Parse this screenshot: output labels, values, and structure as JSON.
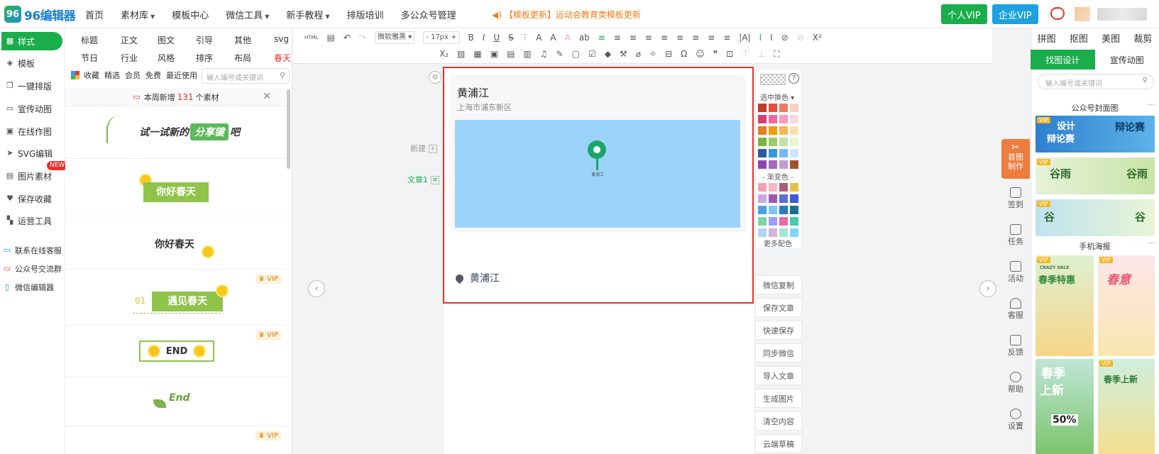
{
  "app": {
    "name": "96编辑器",
    "logo_mark": "96"
  },
  "nav": {
    "items": [
      {
        "label": "首页",
        "caret": false
      },
      {
        "label": "素材库",
        "caret": true
      },
      {
        "label": "模板中心",
        "caret": false
      },
      {
        "label": "微信工具",
        "caret": true
      },
      {
        "label": "新手教程",
        "caret": true
      },
      {
        "label": "排版培训",
        "caret": false
      },
      {
        "label": "多公众号管理",
        "caret": false
      }
    ],
    "notice": "【模板更新】运动会教育类模板更新"
  },
  "header_buttons": {
    "personal_vip": "个人VIP",
    "company_vip": "企业VIP"
  },
  "left_nav": {
    "items": [
      {
        "label": "样式",
        "icon": "grid-icon"
      },
      {
        "label": "模板",
        "icon": "layers-icon"
      },
      {
        "label": "一键排版",
        "icon": "copy-icon"
      },
      {
        "label": "宣传动图",
        "icon": "gif-icon"
      },
      {
        "label": "在线作图",
        "icon": "image-icon"
      },
      {
        "label": "SVG编辑",
        "icon": "pointer-icon"
      },
      {
        "label": "图片素材",
        "icon": "picture-icon"
      },
      {
        "label": "保存收藏",
        "icon": "heart-icon"
      },
      {
        "label": "运营工具",
        "icon": "apps-icon"
      }
    ],
    "new_badge": "NEW",
    "links": [
      {
        "label": "联系在线客服"
      },
      {
        "label": "公众号交流群"
      },
      {
        "label": "微信编辑器"
      }
    ]
  },
  "panel": {
    "categories_row1": [
      "标题",
      "正文",
      "图文",
      "引导",
      "其他",
      "svg"
    ],
    "categories_row2": [
      "节日",
      "行业",
      "风格",
      "排序",
      "布局",
      "春天"
    ],
    "filters": [
      "收藏",
      "精选",
      "会员",
      "免费",
      "最近使用"
    ],
    "search_placeholder": "输入编号或关键词",
    "new_notice_prefix": "本周新增",
    "new_count": "131",
    "new_notice_suffix": "个素材",
    "materials": {
      "m1_prefix": "试一试新的",
      "m1_button": "分享键",
      "m1_suffix": "吧",
      "m2_text": "你好春天",
      "m3_text": "你好春天",
      "m4_num": "01",
      "m4_text": "遇见春天",
      "m5_text": "END",
      "m6_text": "End",
      "vip_label": "VIP"
    }
  },
  "toolbar": {
    "html_label": "HTML",
    "font_family": "微软雅黑",
    "font_size": "17px",
    "font_minus": "-",
    "font_plus": "+",
    "ops_row1": [
      "B",
      "I",
      "U",
      "S",
      "T",
      "A",
      "A",
      "A",
      "ab",
      "≡",
      "≡",
      "≡",
      "≡",
      "≡",
      "≡",
      "≡",
      "≡",
      "≡",
      "|A|",
      "I",
      "I",
      "⊘",
      "⊘",
      "X²"
    ],
    "ops_row2": [
      "X₂",
      "▧",
      "▦",
      "▣",
      "▤",
      "▥",
      "♫",
      "✎",
      "▢",
      "☑",
      "◆",
      "⚒",
      "⌀",
      "✧",
      "⊟",
      "Ω",
      "☺",
      "❞",
      "⊡",
      "⊤",
      "⊥",
      "⛶"
    ]
  },
  "editor": {
    "side_new": "新建",
    "side_article": "文章1",
    "card": {
      "title": "黄浦江",
      "address": "上海市浦东新区",
      "pin_label": "黄浦江",
      "bottom_location": "黄浦江"
    }
  },
  "color_panel": {
    "selected_label": "选中换色",
    "gradient_label": "- 渐变色 -",
    "more_label": "更多配色",
    "help": "?",
    "solid_colors": [
      "#c0392b",
      "#e84c3d",
      "#f07a5f",
      "#f9d0c4",
      "#d63c74",
      "#ec6a9c",
      "#f59bbd",
      "#fbd6e3",
      "#e67e22",
      "#f39c12",
      "#f6b756",
      "#fbe0b0",
      "#7cb342",
      "#9ccc65",
      "#c5e1a5",
      "#e8f5d1",
      "#2c5aa0",
      "#3498db",
      "#74b9ff",
      "#cfe7fb",
      "#8e44ad",
      "#a569bd",
      "#c39bd3",
      "#a0522d"
    ],
    "gradient_colors": [
      "#f2a2b4",
      "#f7b7c3",
      "#b05a7a",
      "#e0c34a",
      "#c8a8e0",
      "#9b59b6",
      "#5b6fd6",
      "#3d5bd9",
      "#4aa3df",
      "#7fc7f0",
      "#2b7bbd",
      "#1a6f8a",
      "#7ed6a5",
      "#a29bfe",
      "#e66aa3",
      "#48c9b0",
      "#aed6f1",
      "#d2b4de",
      "#a3e4d7",
      "#81d4fa"
    ]
  },
  "action_buttons": [
    "微信复制",
    "保存文章",
    "快速保存",
    "同步微信",
    "导入文章",
    "生成图片",
    "清空内容",
    "云端草稿"
  ],
  "right_tools": [
    {
      "label": "首图\n制作",
      "icon": "scissors-icon"
    },
    {
      "label": "签到",
      "icon": "calendar-icon"
    },
    {
      "label": "任务",
      "icon": "task-icon"
    },
    {
      "label": "活动",
      "icon": "gift-icon"
    },
    {
      "label": "客服",
      "icon": "headset-icon"
    },
    {
      "label": "反馈",
      "icon": "edit-icon"
    },
    {
      "label": "帮助",
      "icon": "help-icon"
    },
    {
      "label": "设置",
      "icon": "settings-icon"
    }
  ],
  "right_panel": {
    "tabs": [
      "拼图",
      "抠图",
      "美图",
      "裁剪"
    ],
    "sub_tabs": [
      "找图设计",
      "宣传动图"
    ],
    "search_placeholder": "输入编号或关键词",
    "section1": "公众号封面图",
    "section2": "手机海报",
    "more": "···",
    "thumbs": {
      "t1a": "设计",
      "t1b": "辩论赛",
      "t1c": "辩论赛",
      "t2a": "谷雨",
      "t2b": "谷雨",
      "t3a": "谷",
      "t3b": "谷",
      "t4a": "春季特惠",
      "t4b": "CRAZY SALE",
      "t5a": "春意",
      "t6a": "春季",
      "t6b": "上新",
      "t6c": "50%",
      "t7a": "春季上新",
      "vip": "VIP"
    }
  }
}
